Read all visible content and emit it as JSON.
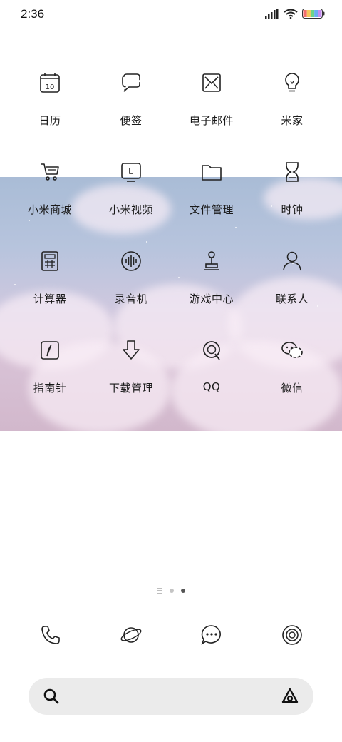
{
  "status_bar": {
    "time": "2:36",
    "battery_colors": [
      "#f26c6c",
      "#f6c65b",
      "#6cd48a",
      "#6aaef0",
      "#c58ef0"
    ]
  },
  "apps": [
    {
      "label": "日历",
      "icon": "calendar-icon",
      "icon_text": "10"
    },
    {
      "label": "便签",
      "icon": "notes-bubble-icon"
    },
    {
      "label": "电子邮件",
      "icon": "email-icon"
    },
    {
      "label": "米家",
      "icon": "lightbulb-icon"
    },
    {
      "label": "小米商城",
      "icon": "shopping-cart-icon"
    },
    {
      "label": "小米视频",
      "icon": "video-icon"
    },
    {
      "label": "文件管理",
      "icon": "folder-icon"
    },
    {
      "label": "时钟",
      "icon": "hourglass-clock-icon"
    },
    {
      "label": "计算器",
      "icon": "calculator-icon"
    },
    {
      "label": "录音机",
      "icon": "recorder-icon"
    },
    {
      "label": "游戏中心",
      "icon": "joystick-icon"
    },
    {
      "label": "联系人",
      "icon": "contacts-person-icon"
    },
    {
      "label": "指南针",
      "icon": "compass-icon"
    },
    {
      "label": "下载管理",
      "icon": "download-icon"
    },
    {
      "label": "QQ",
      "icon": "qq-icon"
    },
    {
      "label": "微信",
      "icon": "wechat-icon"
    }
  ],
  "pages": {
    "count": 2,
    "active": 1
  },
  "dock": [
    {
      "icon": "phone-icon"
    },
    {
      "icon": "browser-planet-icon"
    },
    {
      "icon": "messages-icon"
    },
    {
      "icon": "camera-icon"
    }
  ],
  "search": {
    "icon": "search-icon",
    "assistant_icon": "app-vault-icon"
  }
}
